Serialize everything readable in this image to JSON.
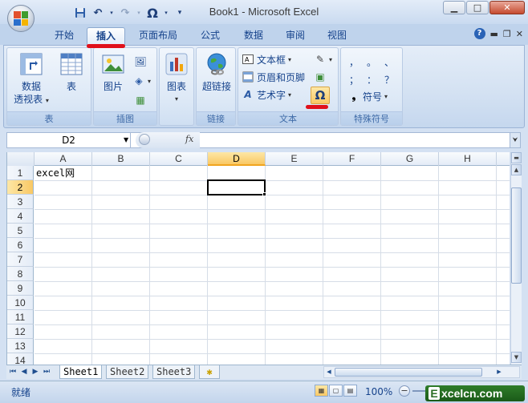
{
  "window": {
    "title": "Book1 - Microsoft Excel",
    "controls": {
      "minimize": "▁",
      "maximize": "□",
      "close": "✕"
    }
  },
  "quick_access": [
    {
      "icon": "save-icon"
    },
    {
      "icon": "undo-icon"
    },
    {
      "icon": "redo-icon"
    },
    {
      "icon": "omega-symbol-icon",
      "label": "Ω"
    },
    {
      "icon": "customize-dropdown-icon"
    }
  ],
  "tabs": [
    {
      "label": "开始",
      "active": false
    },
    {
      "label": "插入",
      "active": true
    },
    {
      "label": "页面布局",
      "active": false
    },
    {
      "label": "公式",
      "active": false
    },
    {
      "label": "数据",
      "active": false
    },
    {
      "label": "审阅",
      "active": false
    },
    {
      "label": "视图",
      "active": false
    }
  ],
  "ribbon": {
    "groups": {
      "tables": {
        "label": "表",
        "pivot_label": "数据\n透视表",
        "pivot_line1": "数据",
        "pivot_line2": "透视表",
        "table_label": "表"
      },
      "illustrations": {
        "label": "插图",
        "picture_label": "图片"
      },
      "charts": {
        "label": "图表"
      },
      "links": {
        "label": "链接",
        "hyperlink_label": "超链接"
      },
      "text": {
        "label": "文本",
        "textbox_label": "文本框",
        "header_footer_label": "页眉和页脚",
        "wordart_label": "艺术字",
        "symbol_glyph": "Ω"
      },
      "special": {
        "label": "特殊符号",
        "symbols": [
          "，",
          "。",
          "、",
          "；",
          "：",
          "？"
        ],
        "symbol_button_label": "符号"
      }
    }
  },
  "formula_bar": {
    "name_box": "D2",
    "fx": "fx",
    "value": ""
  },
  "sheet": {
    "columns": [
      "A",
      "B",
      "C",
      "D",
      "E",
      "F",
      "G",
      "H"
    ],
    "selected_column": "D",
    "rows": [
      "1",
      "2",
      "3",
      "4",
      "5",
      "6",
      "7",
      "8",
      "9",
      "10",
      "11",
      "12",
      "13",
      "14"
    ],
    "selected_row": "2",
    "cells": {
      "A1": "excel网"
    },
    "active_cell": "D2"
  },
  "sheet_tabs": [
    "Sheet1",
    "Sheet2",
    "Sheet3"
  ],
  "active_sheet": "Sheet1",
  "status": {
    "text": "就绪",
    "zoom": "100%"
  },
  "watermark": {
    "letter": "E",
    "text": "xcelcn.com"
  },
  "colors": {
    "accent": "#15428b",
    "annotation": "#e0101a",
    "selection": "#f9c864"
  }
}
